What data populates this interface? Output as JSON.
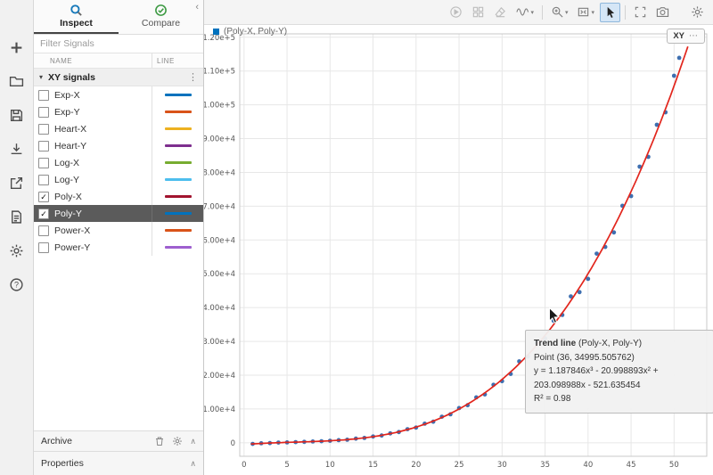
{
  "icons": {
    "triangle_down": "▾",
    "kebab": "⋮",
    "overflow_dots": "⋯",
    "check": "✓",
    "chevron_up": "∧",
    "collapse_left": "‹",
    "caret_down": "▾"
  },
  "panel": {
    "tabs": [
      {
        "label": "Inspect"
      },
      {
        "label": "Compare"
      }
    ],
    "filter_placeholder": "Filter Signals",
    "columns": {
      "name": "NAME",
      "line": "LINE"
    },
    "group_label": "XY signals",
    "signals": [
      {
        "name": "Exp-X",
        "checked": false,
        "selected": false,
        "color": "#0072BD"
      },
      {
        "name": "Exp-Y",
        "checked": false,
        "selected": false,
        "color": "#D95319"
      },
      {
        "name": "Heart-X",
        "checked": false,
        "selected": false,
        "color": "#EDB120"
      },
      {
        "name": "Heart-Y",
        "checked": false,
        "selected": false,
        "color": "#7E2F8E"
      },
      {
        "name": "Log-X",
        "checked": false,
        "selected": false,
        "color": "#77AC30"
      },
      {
        "name": "Log-Y",
        "checked": false,
        "selected": false,
        "color": "#4DBEEE"
      },
      {
        "name": "Poly-X",
        "checked": true,
        "selected": false,
        "color": "#A2142F"
      },
      {
        "name": "Poly-Y",
        "checked": true,
        "selected": true,
        "color": "#0072BD"
      },
      {
        "name": "Power-X",
        "checked": false,
        "selected": false,
        "color": "#D95319"
      },
      {
        "name": "Power-Y",
        "checked": false,
        "selected": false,
        "color": "#9E5FCF"
      }
    ],
    "archive_label": "Archive",
    "properties_label": "Properties"
  },
  "chart": {
    "legend_label": "(Poly-X, Poly-Y)",
    "legend_color": "#0072BD",
    "badge_label": "XY"
  },
  "tooltip": {
    "title_bold": "Trend line",
    "title_rest": " (Poly-X, Poly-Y)",
    "point_line": "Point (36, 34995.505762)",
    "equation": "y = 1.187846x³ - 20.998893x² + 203.098988x - 521.635454",
    "r_squared": "R² = 0.98"
  },
  "chart_data": {
    "type": "scatter",
    "title": "(Poly-X, Poly-Y)",
    "xlim": [
      -0.5,
      53.8
    ],
    "ylim": [
      -4000,
      121000
    ],
    "x_ticks": [
      0,
      5,
      10,
      15,
      20,
      25,
      30,
      35,
      40,
      45,
      50
    ],
    "y_ticks": [
      {
        "value": 0,
        "label": "0"
      },
      {
        "value": 10000,
        "label": "1.00e+4"
      },
      {
        "value": 20000,
        "label": "2.00e+4"
      },
      {
        "value": 30000,
        "label": "3.00e+4"
      },
      {
        "value": 40000,
        "label": "4.00e+4"
      },
      {
        "value": 50000,
        "label": "5.00e+4"
      },
      {
        "value": 60000,
        "label": "6.00e+4"
      },
      {
        "value": 70000,
        "label": "7.00e+4"
      },
      {
        "value": 80000,
        "label": "8.00e+4"
      },
      {
        "value": 90000,
        "label": "9.00e+4"
      },
      {
        "value": 100000,
        "label": "1.00e+5"
      },
      {
        "value": 110000,
        "label": "1.10e+5"
      },
      {
        "value": 120000,
        "label": "1.20e+5"
      }
    ],
    "point_color": "#3E6FB0",
    "trend_color": "#E2251C",
    "trend_coeffs": [
      1.187846,
      -20.998893,
      203.098988,
      -521.635454
    ],
    "points": [
      [
        1,
        -340
      ],
      [
        2,
        -160
      ],
      [
        3,
        -95
      ],
      [
        4,
        55
      ],
      [
        5,
        115
      ],
      [
        6,
        205
      ],
      [
        7,
        265
      ],
      [
        8,
        385
      ],
      [
        9,
        455
      ],
      [
        10,
        585
      ],
      [
        11,
        775
      ],
      [
        12,
        905
      ],
      [
        13,
        1210
      ],
      [
        14,
        1430
      ],
      [
        15,
        1855
      ],
      [
        16,
        2145
      ],
      [
        17,
        2780
      ],
      [
        18,
        3170
      ],
      [
        19,
        4020
      ],
      [
        20,
        4500
      ],
      [
        21,
        5640
      ],
      [
        22,
        6230
      ],
      [
        23,
        7710
      ],
      [
        24,
        8420
      ],
      [
        25,
        10280
      ],
      [
        26,
        11100
      ],
      [
        27,
        13420
      ],
      [
        28,
        14300
      ],
      [
        29,
        17160
      ],
      [
        30,
        18230
      ],
      [
        31,
        20370
      ],
      [
        32,
        24080
      ],
      [
        33,
        25530
      ],
      [
        34,
        29590
      ],
      [
        35,
        30890
      ],
      [
        36,
        36110
      ],
      [
        37,
        37820
      ],
      [
        38,
        43310
      ],
      [
        39,
        44580
      ],
      [
        40,
        48500
      ],
      [
        41,
        55980
      ],
      [
        42,
        57940
      ],
      [
        43,
        62250
      ],
      [
        44,
        70130
      ],
      [
        45,
        73000
      ],
      [
        46,
        81700
      ],
      [
        47,
        84600
      ],
      [
        48,
        94100
      ],
      [
        49,
        97800
      ],
      [
        50,
        108600
      ],
      [
        50.6,
        113900
      ]
    ]
  }
}
